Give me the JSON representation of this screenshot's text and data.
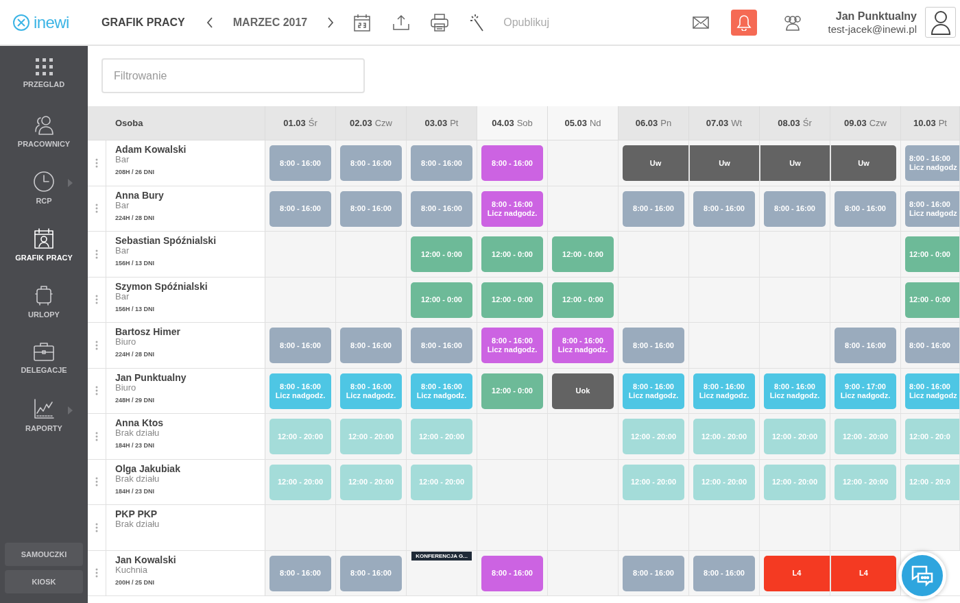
{
  "header": {
    "logo": "inewi",
    "title": "GRAFIK PRACY",
    "period": "MARZEC 2017",
    "publish": {
      "label": "Opublikuj",
      "disabled": true
    },
    "notifications": {
      "active": true
    },
    "user": {
      "name": "Jan Punktualny",
      "email": "test-jacek@inewi.pl"
    }
  },
  "sidebar": {
    "items": [
      {
        "label": "PRZEGLAD",
        "selected": false,
        "submenu": false
      },
      {
        "label": "PRACOWNICY",
        "selected": false,
        "submenu": false
      },
      {
        "label": "RCP",
        "selected": false,
        "submenu": true
      },
      {
        "label": "GRAFIK PRACY",
        "selected": true,
        "submenu": false
      },
      {
        "label": "URLOPY",
        "selected": false,
        "submenu": false
      },
      {
        "label": "DELEGACJE",
        "selected": false,
        "submenu": false
      },
      {
        "label": "RAPORTY",
        "selected": false,
        "submenu": true
      }
    ],
    "buttons": [
      "SAMOUCZKI",
      "KIOSK"
    ]
  },
  "filter": {
    "placeholder": "Filtrowanie"
  },
  "table": {
    "person_heading": "Osoba",
    "columns": [
      {
        "date": "01.03",
        "day": "Śr",
        "weekend": false
      },
      {
        "date": "02.03",
        "day": "Czw",
        "weekend": false
      },
      {
        "date": "03.03",
        "day": "Pt",
        "weekend": false
      },
      {
        "date": "04.03",
        "day": "Sob",
        "weekend": true
      },
      {
        "date": "05.03",
        "day": "Nd",
        "weekend": true
      },
      {
        "date": "06.03",
        "day": "Pn",
        "weekend": false
      },
      {
        "date": "07.03",
        "day": "Wt",
        "weekend": false
      },
      {
        "date": "08.03",
        "day": "Śr",
        "weekend": false
      },
      {
        "date": "09.03",
        "day": "Czw",
        "weekend": false
      },
      {
        "date": "10.03",
        "day": "Pt",
        "weekend": false
      }
    ],
    "rows": [
      {
        "name": "Adam Kowalski",
        "department": "Bar",
        "hours": "208H / 26 DNI",
        "cells": [
          {
            "kind": "regular",
            "time": "8:00 - 16:00"
          },
          {
            "kind": "regular",
            "time": "8:00 - 16:00"
          },
          {
            "kind": "regular",
            "time": "8:00 - 16:00"
          },
          {
            "kind": "weekend",
            "time": "8:00 - 16:00"
          },
          null,
          {
            "kind": "leave",
            "time": "Uw"
          },
          {
            "kind": "leave",
            "time": "Uw"
          },
          {
            "kind": "leave",
            "time": "Uw"
          },
          {
            "kind": "leave",
            "time": "Uw"
          },
          {
            "kind": "regular",
            "time": "8:00 - 16:00",
            "note": "Licz nadgodz"
          }
        ]
      },
      {
        "name": "Anna Bury",
        "department": "Bar",
        "hours": "224H / 28 DNI",
        "cells": [
          {
            "kind": "regular",
            "time": "8:00 - 16:00"
          },
          {
            "kind": "regular",
            "time": "8:00 - 16:00"
          },
          {
            "kind": "regular",
            "time": "8:00 - 16:00"
          },
          {
            "kind": "weekend",
            "time": "8:00 - 16:00",
            "note": "Licz nadgodz."
          },
          null,
          {
            "kind": "regular",
            "time": "8:00 - 16:00"
          },
          {
            "kind": "regular",
            "time": "8:00 - 16:00"
          },
          {
            "kind": "regular",
            "time": "8:00 - 16:00"
          },
          {
            "kind": "regular",
            "time": "8:00 - 16:00"
          },
          {
            "kind": "regular",
            "time": "8:00 - 16:00",
            "note": "Licz nadgodz"
          }
        ]
      },
      {
        "name": "Sebastian Spóźnialski",
        "department": "Bar",
        "hours": "156H / 13 DNI",
        "cells": [
          null,
          null,
          {
            "kind": "night",
            "time": "12:00 - 0:00"
          },
          {
            "kind": "night",
            "time": "12:00 - 0:00"
          },
          {
            "kind": "night",
            "time": "12:00 - 0:00"
          },
          null,
          null,
          null,
          null,
          {
            "kind": "night",
            "time": "12:00 - 0:00"
          }
        ]
      },
      {
        "name": "Szymon Spóźnialski",
        "department": "Bar",
        "hours": "156H / 13 DNI",
        "cells": [
          null,
          null,
          {
            "kind": "night",
            "time": "12:00 - 0:00"
          },
          {
            "kind": "night",
            "time": "12:00 - 0:00"
          },
          {
            "kind": "night",
            "time": "12:00 - 0:00"
          },
          null,
          null,
          null,
          null,
          {
            "kind": "night",
            "time": "12:00 - 0:00"
          }
        ]
      },
      {
        "name": "Bartosz Himer",
        "department": "Biuro",
        "hours": "224H / 28 DNI",
        "cells": [
          {
            "kind": "regular",
            "time": "8:00 - 16:00"
          },
          {
            "kind": "regular",
            "time": "8:00 - 16:00"
          },
          {
            "kind": "regular",
            "time": "8:00 - 16:00"
          },
          {
            "kind": "weekend",
            "time": "8:00 - 16:00",
            "note": "Licz nadgodz."
          },
          {
            "kind": "weekend",
            "time": "8:00 - 16:00",
            "note": "Licz nadgodz."
          },
          {
            "kind": "regular",
            "time": "8:00 - 16:00"
          },
          null,
          null,
          {
            "kind": "regular",
            "time": "8:00 - 16:00"
          },
          {
            "kind": "regular",
            "time": "8:00 - 16:00"
          }
        ]
      },
      {
        "name": "Jan Punktualny",
        "department": "Biuro",
        "hours": "248H / 29 DNI",
        "cells": [
          {
            "kind": "overtime",
            "time": "8:00 - 16:00",
            "note": "Licz nadgodz."
          },
          {
            "kind": "overtime",
            "time": "8:00 - 16:00",
            "note": "Licz nadgodz."
          },
          {
            "kind": "overtime",
            "time": "8:00 - 16:00",
            "note": "Licz nadgodz."
          },
          {
            "kind": "night",
            "time": "12:00 - 0:00"
          },
          {
            "kind": "leave",
            "time": "Uok"
          },
          {
            "kind": "overtime",
            "time": "8:00 - 16:00",
            "note": "Licz nadgodz."
          },
          {
            "kind": "overtime",
            "time": "8:00 - 16:00",
            "note": "Licz nadgodz."
          },
          {
            "kind": "overtime",
            "time": "8:00 - 16:00",
            "note": "Licz nadgodz."
          },
          {
            "kind": "overtime",
            "time": "9:00 - 17:00",
            "note": "Licz nadgodz."
          },
          {
            "kind": "overtime",
            "time": "8:00 - 16:00",
            "note": "Licz nadgodz"
          }
        ]
      },
      {
        "name": "Anna Ktos",
        "department": "Brak działu",
        "hours": "184H / 23 DNI",
        "cells": [
          {
            "kind": "part",
            "time": "12:00 - 20:00"
          },
          {
            "kind": "part",
            "time": "12:00 - 20:00"
          },
          {
            "kind": "part",
            "time": "12:00 - 20:00"
          },
          null,
          null,
          {
            "kind": "part",
            "time": "12:00 - 20:00"
          },
          {
            "kind": "part",
            "time": "12:00 - 20:00"
          },
          {
            "kind": "part",
            "time": "12:00 - 20:00"
          },
          {
            "kind": "part",
            "time": "12:00 - 20:00"
          },
          {
            "kind": "part",
            "time": "12:00 - 20:0"
          }
        ]
      },
      {
        "name": "Olga Jakubiak",
        "department": "Brak działu",
        "hours": "184H / 23 DNI",
        "cells": [
          {
            "kind": "part",
            "time": "12:00 - 20:00"
          },
          {
            "kind": "part",
            "time": "12:00 - 20:00"
          },
          {
            "kind": "part",
            "time": "12:00 - 20:00"
          },
          null,
          null,
          {
            "kind": "part",
            "time": "12:00 - 20:00"
          },
          {
            "kind": "part",
            "time": "12:00 - 20:00"
          },
          {
            "kind": "part",
            "time": "12:00 - 20:00"
          },
          {
            "kind": "part",
            "time": "12:00 - 20:00"
          },
          {
            "kind": "part",
            "time": "12:00 - 20:0"
          }
        ]
      },
      {
        "name": "PKP PKP",
        "department": "Brak działu",
        "cells": [
          null,
          null,
          null,
          null,
          null,
          null,
          null,
          null,
          null,
          null
        ]
      },
      {
        "name": "Jan Kowalski",
        "department": "Kuchnia",
        "hours": "200H / 25 DNI",
        "cells": [
          {
            "kind": "regular",
            "time": "8:00 - 16:00"
          },
          {
            "kind": "regular",
            "time": "8:00 - 16:00"
          },
          {
            "kind": "event",
            "label": "KONFERENCJA G..."
          },
          {
            "kind": "weekend",
            "time": "8:00 - 16:00"
          },
          null,
          {
            "kind": "regular",
            "time": "8:00 - 16:00"
          },
          {
            "kind": "regular",
            "time": "8:00 - 16:00"
          },
          {
            "kind": "sick",
            "time": "L4"
          },
          {
            "kind": "sick",
            "time": "L4"
          },
          null
        ]
      }
    ]
  }
}
